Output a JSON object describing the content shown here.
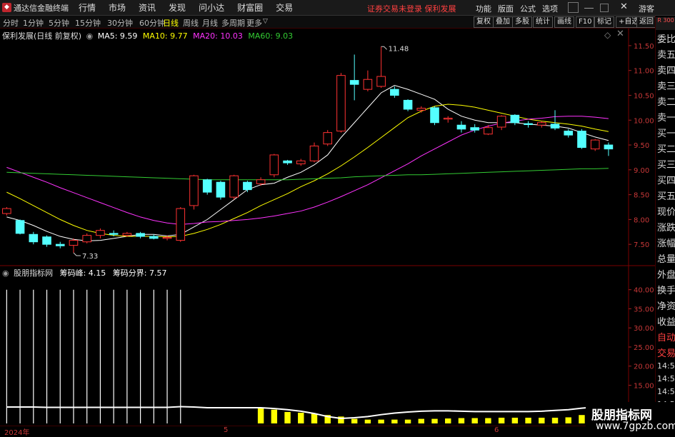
{
  "menubar": {
    "app_title": "通达信金融终端",
    "items": [
      "行情",
      "市场",
      "资讯",
      "发现",
      "问小达",
      "财富圈",
      "交易"
    ],
    "warning": "证券交易未登录  保利发展",
    "right_items": [
      "功能",
      "版面",
      "公式",
      "选项"
    ],
    "guest": "游客"
  },
  "toolbar": {
    "periods": [
      "分时",
      "1分钟",
      "5分钟",
      "15分钟",
      "30分钟",
      "60分钟",
      "日线",
      "周线",
      "月线",
      "多周期",
      "更多"
    ],
    "active_period": "日线",
    "buttons": [
      "复权",
      "叠加",
      "多股",
      "统计",
      "画线",
      "F10",
      "标记",
      "+自选",
      "返回"
    ]
  },
  "main_chart": {
    "stock_label": "保利发展(日线 前复权)",
    "ma": [
      {
        "label": "MA5: 9.59",
        "color": "#ffffff",
        "key": "ma5"
      },
      {
        "label": "MA10: 9.77",
        "color": "#ffff00",
        "key": "ma10"
      },
      {
        "label": "MA20: 10.03",
        "color": "#ff33ff",
        "key": "ma20"
      },
      {
        "label": "MA60: 9.03",
        "color": "#33cc33",
        "key": "ma60"
      }
    ],
    "high_label": "11.48",
    "low_label": "7.33"
  },
  "sub_chart": {
    "indicator": "股朋指标网",
    "values": [
      {
        "label": "筹码峰: 4.15",
        "color": "#ffffff"
      },
      {
        "label": "筹码分界: 7.57",
        "color": "#ffffff"
      }
    ]
  },
  "right_panel": {
    "badge": "R 300",
    "items": [
      "委比",
      "卖五",
      "卖四",
      "卖三",
      "卖二",
      "卖一",
      "买一",
      "买二",
      "买三",
      "买四",
      "买五",
      "现价",
      "涨跌",
      "涨幅",
      "总量",
      "外盘",
      "换手",
      "净资",
      "收益",
      "自动",
      "交易",
      "14:5",
      "14:5",
      "14:5",
      "14:5",
      "14:5",
      "14:5",
      "14:5",
      "14:5"
    ]
  },
  "date_axis": [
    "2024年",
    "5",
    "6"
  ],
  "watermark": {
    "line1": "股朋指标网",
    "line2": "www.7gpzb.com"
  },
  "chart_data": [
    {
      "type": "candlestick",
      "y_ticks": [
        7.5,
        8.0,
        8.5,
        9.0,
        9.5,
        10.0,
        10.5,
        11.0,
        11.5
      ],
      "ylim": [
        7.1,
        11.7
      ],
      "grid": false,
      "candles": [
        {
          "o": 8.12,
          "c": 8.22,
          "h": 8.25,
          "l": 8.08
        },
        {
          "o": 7.98,
          "c": 7.72,
          "h": 8.0,
          "l": 7.7
        },
        {
          "o": 7.7,
          "c": 7.55,
          "h": 7.75,
          "l": 7.5
        },
        {
          "o": 7.65,
          "c": 7.5,
          "h": 7.68,
          "l": 7.45
        },
        {
          "o": 7.5,
          "c": 7.47,
          "h": 7.55,
          "l": 7.42
        },
        {
          "o": 7.48,
          "c": 7.58,
          "h": 7.62,
          "l": 7.33
        },
        {
          "o": 7.55,
          "c": 7.68,
          "h": 7.72,
          "l": 7.52
        },
        {
          "o": 7.68,
          "c": 7.78,
          "h": 7.82,
          "l": 7.62
        },
        {
          "o": 7.72,
          "c": 7.7,
          "h": 7.78,
          "l": 7.66
        },
        {
          "o": 7.68,
          "c": 7.72,
          "h": 7.75,
          "l": 7.65
        },
        {
          "o": 7.72,
          "c": 7.66,
          "h": 7.75,
          "l": 7.62
        },
        {
          "o": 7.66,
          "c": 7.62,
          "h": 7.7,
          "l": 7.6
        },
        {
          "o": 7.62,
          "c": 7.64,
          "h": 7.68,
          "l": 7.58
        },
        {
          "o": 7.58,
          "c": 8.22,
          "h": 8.25,
          "l": 7.55
        },
        {
          "o": 8.28,
          "c": 8.88,
          "h": 8.9,
          "l": 8.2
        },
        {
          "o": 8.8,
          "c": 8.55,
          "h": 8.82,
          "l": 8.5
        },
        {
          "o": 8.75,
          "c": 8.45,
          "h": 8.78,
          "l": 8.4
        },
        {
          "o": 8.45,
          "c": 8.88,
          "h": 8.9,
          "l": 8.4
        },
        {
          "o": 8.75,
          "c": 8.6,
          "h": 8.78,
          "l": 8.55
        },
        {
          "o": 8.72,
          "c": 8.8,
          "h": 8.85,
          "l": 8.68
        },
        {
          "o": 8.9,
          "c": 9.3,
          "h": 9.32,
          "l": 8.85
        },
        {
          "o": 9.18,
          "c": 9.14,
          "h": 9.2,
          "l": 9.1
        },
        {
          "o": 9.12,
          "c": 9.18,
          "h": 9.22,
          "l": 9.08
        },
        {
          "o": 9.18,
          "c": 9.48,
          "h": 9.55,
          "l": 9.15
        },
        {
          "o": 9.52,
          "c": 9.75,
          "h": 9.8,
          "l": 9.48
        },
        {
          "o": 9.78,
          "c": 10.9,
          "h": 10.95,
          "l": 9.75
        },
        {
          "o": 10.8,
          "c": 10.72,
          "h": 11.32,
          "l": 10.4
        },
        {
          "o": 10.62,
          "c": 10.82,
          "h": 11.0,
          "l": 10.58
        },
        {
          "o": 10.68,
          "c": 10.88,
          "h": 11.48,
          "l": 10.65
        },
        {
          "o": 10.62,
          "c": 10.5,
          "h": 10.68,
          "l": 10.45
        },
        {
          "o": 10.4,
          "c": 10.22,
          "h": 10.42,
          "l": 10.18
        },
        {
          "o": 10.2,
          "c": 10.24,
          "h": 10.28,
          "l": 10.15
        },
        {
          "o": 10.25,
          "c": 9.95,
          "h": 10.28,
          "l": 9.9
        },
        {
          "o": 10.02,
          "c": 10.04,
          "h": 10.08,
          "l": 9.95
        },
        {
          "o": 9.9,
          "c": 9.82,
          "h": 9.98,
          "l": 9.75
        },
        {
          "o": 9.85,
          "c": 9.8,
          "h": 9.92,
          "l": 9.75
        },
        {
          "o": 9.72,
          "c": 9.85,
          "h": 9.9,
          "l": 9.7
        },
        {
          "o": 9.86,
          "c": 10.08,
          "h": 10.1,
          "l": 9.8
        },
        {
          "o": 10.1,
          "c": 9.95,
          "h": 10.12,
          "l": 9.9
        },
        {
          "o": 9.93,
          "c": 9.91,
          "h": 9.98,
          "l": 9.85
        },
        {
          "o": 9.9,
          "c": 9.95,
          "h": 9.98,
          "l": 9.85
        },
        {
          "o": 9.92,
          "c": 9.84,
          "h": 10.2,
          "l": 9.8
        },
        {
          "o": 9.78,
          "c": 9.7,
          "h": 9.82,
          "l": 9.65
        },
        {
          "o": 9.78,
          "c": 9.45,
          "h": 9.82,
          "l": 9.42
        },
        {
          "o": 9.42,
          "c": 9.6,
          "h": 9.62,
          "l": 9.38
        },
        {
          "o": 9.5,
          "c": 9.42,
          "h": 9.55,
          "l": 9.28
        }
      ],
      "ma_series": {
        "ma5": [
          8.05,
          7.98,
          7.88,
          7.76,
          7.66,
          7.6,
          7.57,
          7.58,
          7.62,
          7.66,
          7.7,
          7.7,
          7.67,
          7.7,
          7.85,
          8.0,
          8.2,
          8.4,
          8.6,
          8.7,
          8.73,
          8.85,
          8.95,
          9.1,
          9.3,
          9.65,
          9.95,
          10.25,
          10.55,
          10.7,
          10.62,
          10.52,
          10.42,
          10.22,
          10.08,
          10.0,
          9.95,
          9.95,
          9.95,
          9.92,
          9.9,
          9.88,
          9.84,
          9.75,
          9.66,
          9.59
        ],
        "ma10": [
          8.55,
          8.42,
          8.28,
          8.14,
          8.0,
          7.88,
          7.78,
          7.72,
          7.68,
          7.66,
          7.66,
          7.66,
          7.65,
          7.66,
          7.72,
          7.8,
          7.9,
          8.02,
          8.14,
          8.28,
          8.4,
          8.52,
          8.66,
          8.78,
          8.92,
          9.08,
          9.26,
          9.45,
          9.65,
          9.85,
          10.05,
          10.18,
          10.28,
          10.32,
          10.3,
          10.26,
          10.2,
          10.14,
          10.08,
          10.02,
          9.98,
          9.95,
          9.92,
          9.88,
          9.82,
          9.77
        ],
        "ma20": [
          9.05,
          8.95,
          8.85,
          8.75,
          8.64,
          8.54,
          8.44,
          8.34,
          8.24,
          8.14,
          8.05,
          7.98,
          7.93,
          7.9,
          7.92,
          7.95,
          7.96,
          7.98,
          8.0,
          8.03,
          8.07,
          8.12,
          8.17,
          8.25,
          8.35,
          8.46,
          8.58,
          8.7,
          8.84,
          8.98,
          9.12,
          9.28,
          9.42,
          9.56,
          9.7,
          9.8,
          9.88,
          9.94,
          9.98,
          10.02,
          10.04,
          10.07,
          10.08,
          10.08,
          10.06,
          10.03
        ],
        "ma60": [
          8.95,
          8.94,
          8.93,
          8.92,
          8.91,
          8.9,
          8.89,
          8.88,
          8.87,
          8.86,
          8.85,
          8.84,
          8.83,
          8.82,
          8.81,
          8.8,
          8.8,
          8.8,
          8.8,
          8.8,
          8.8,
          8.8,
          8.81,
          8.82,
          8.83,
          8.84,
          8.86,
          8.87,
          8.88,
          8.89,
          8.9,
          8.9,
          8.91,
          8.92,
          8.93,
          8.94,
          8.95,
          8.96,
          8.97,
          8.98,
          8.99,
          9.0,
          9.01,
          9.02,
          9.02,
          9.03
        ]
      }
    },
    {
      "type": "bar",
      "title": "股朋指标网",
      "y_ticks": [
        10.0,
        15.0,
        20.0,
        25.0,
        30.0,
        35.0,
        40.0
      ],
      "ylim": [
        5.0,
        42.0
      ],
      "white_bars": [
        40,
        40,
        40,
        40,
        40,
        40,
        40,
        40,
        40,
        40,
        40,
        40,
        40,
        40
      ],
      "yellow_bars": [
        0,
        0,
        0,
        0,
        0,
        0,
        0,
        0,
        0,
        0,
        0,
        0,
        0,
        0,
        0,
        0,
        0,
        0,
        0,
        9.2,
        8.6,
        8.0,
        7.8,
        7.6,
        7.2,
        6.8,
        6.2,
        6.0,
        6.0,
        6.0,
        6.0,
        6.2,
        6.2,
        6.3,
        6.4,
        6.4,
        6.4,
        6.5,
        6.5,
        6.5,
        6.5,
        6.5,
        6.6,
        7.2,
        7.0,
        0
      ],
      "white_line": [
        9.3,
        9.3,
        9.3,
        9.2,
        9.2,
        9.2,
        9.2,
        9.2,
        9.2,
        9.2,
        9.2,
        9.2,
        9.2,
        9.4,
        9.3,
        9.1,
        9.1,
        9.1,
        9.1,
        9.1,
        8.9,
        8.6,
        8.2,
        7.6,
        6.8,
        6.3,
        6.5,
        6.8,
        7.3,
        7.7,
        8.0,
        8.2,
        8.3,
        8.3,
        8.2,
        8.1,
        8.1,
        8.1,
        8.1,
        8.1,
        8.2,
        8.4,
        8.6,
        9.0,
        9.3,
        9.3
      ]
    }
  ]
}
